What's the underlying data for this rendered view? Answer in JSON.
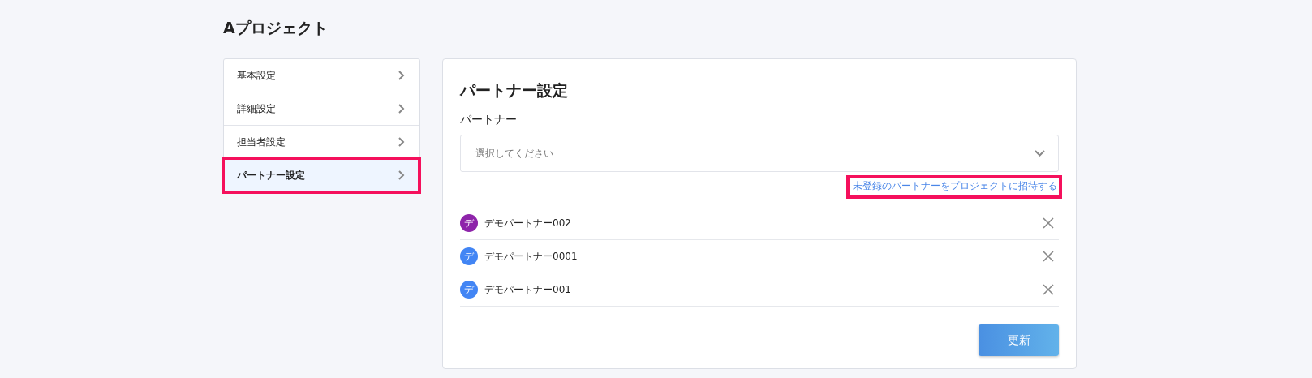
{
  "page": {
    "title": "Aプロジェクト"
  },
  "sidebar": {
    "items": [
      {
        "label": "基本設定",
        "selected": false,
        "highlighted": false
      },
      {
        "label": "詳細設定",
        "selected": false,
        "highlighted": false
      },
      {
        "label": "担当者設定",
        "selected": false,
        "highlighted": false
      },
      {
        "label": "パートナー設定",
        "selected": true,
        "highlighted": true
      }
    ]
  },
  "panel": {
    "title": "パートナー設定",
    "field_label": "パートナー",
    "select": {
      "placeholder": "選択してください"
    },
    "invite_link": {
      "label": "未登録のパートナーをプロジェクトに招待する",
      "highlighted": true
    },
    "partners": [
      {
        "initial": "デ",
        "name": "デモパートナー002",
        "color": "#8e24aa"
      },
      {
        "initial": "デ",
        "name": "デモパートナー0001",
        "color": "#4285f4"
      },
      {
        "initial": "デ",
        "name": "デモパートナー001",
        "color": "#4285f4"
      }
    ],
    "button": "更新"
  }
}
